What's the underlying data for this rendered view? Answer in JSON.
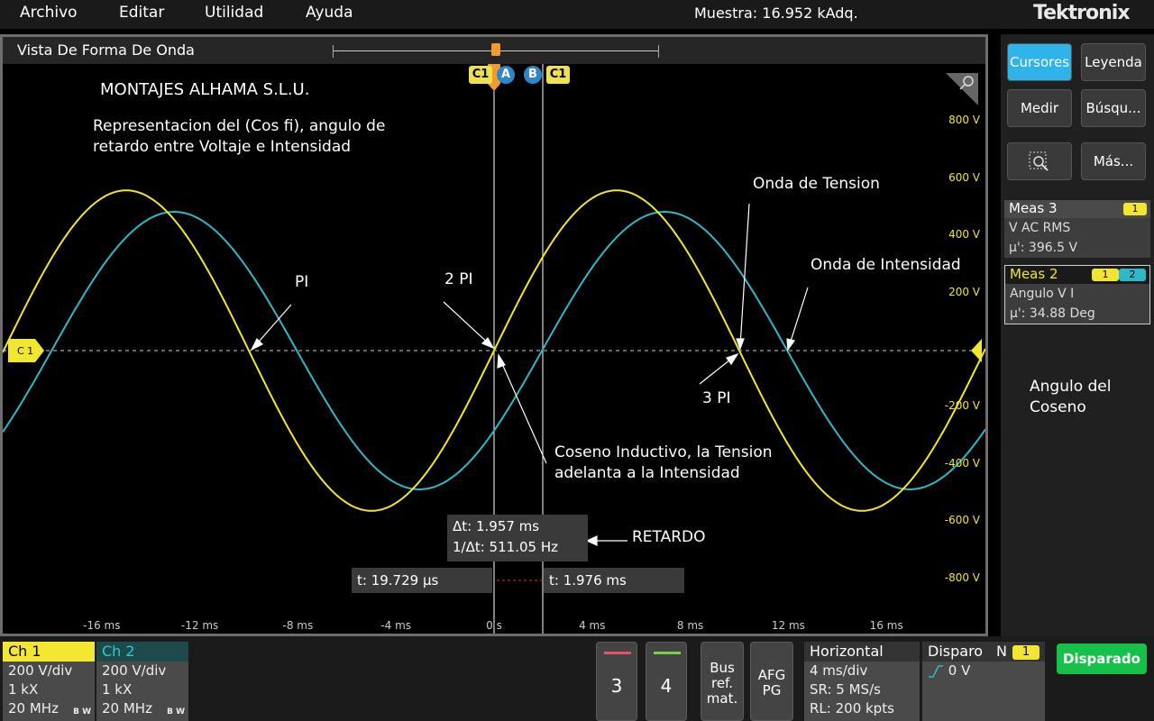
{
  "menu": [
    "Archivo",
    "Editar",
    "Utilidad",
    "Ayuda"
  ],
  "sample_info": "Muestra: 16.952 kAdq.",
  "brand": "Tektronix",
  "waveform_view": {
    "title": "Vista De Forma De Onda",
    "y_ticks": [
      "800 V",
      "600 V",
      "400 V",
      "200 V",
      "-200 V",
      "-400 V",
      "-600 V",
      "-800 V"
    ],
    "x_ticks": [
      "-16 ms",
      "-12 ms",
      "-8 ms",
      "-4 ms",
      "0 s",
      "4 ms",
      "8 ms",
      "12 ms",
      "16 ms"
    ],
    "channel_marker_left": "C 1",
    "cursor_tags": [
      "C1",
      "A",
      "B",
      "C1"
    ],
    "annotations": {
      "company": "MONTAJES ALHAMA S.L.U.",
      "description_line1": "Representacion del (Cos fi), angulo de",
      "description_line2": "retardo entre Voltaje e Intensidad",
      "pi": "PI",
      "two_pi": "2 PI",
      "three_pi": "3 PI",
      "voltage_wave": "Onda de Tension",
      "current_wave": "Onda de Intensidad",
      "inductive_line1": "Coseno Inductivo, la Tension",
      "inductive_line2": "adelanta a la Intensidad",
      "delay": "RETARDO",
      "angle_line1": "Angulo del",
      "angle_line2": "Coseno"
    },
    "readouts": {
      "delta_t": "Δt: 1.957 ms",
      "inv_delta_t": "1/Δt: 511.05 Hz",
      "cursor_a_time": "t: 19.729 µs",
      "cursor_b_time": "t: 1.976 ms"
    },
    "colors": {
      "ch1": "#f2e630",
      "ch2": "#30b8c8"
    }
  },
  "right_panel": {
    "buttons": {
      "cursors": "Cursores",
      "legend": "Leyenda",
      "measure": "Medir",
      "search": "Búsqu...",
      "more": "Más..."
    },
    "meas3": {
      "title": "Meas 3",
      "badge": "1",
      "line1": "V AC RMS",
      "line2": "µ': 396.5 V"
    },
    "meas2": {
      "title": "Meas 2",
      "badge1": "1",
      "badge2": "2",
      "line1": "Angulo V I",
      "line2": "µ': 34.88 Deg"
    }
  },
  "bottom": {
    "ch1": {
      "title": "Ch 1",
      "scale": "200 V/div",
      "impedance": "1 kX",
      "bandwidth": "20 MHz",
      "bw": "B W"
    },
    "ch2": {
      "title": "Ch 2",
      "scale": "200 V/div",
      "impedance": "1 kX",
      "bandwidth": "20 MHz",
      "bw": "B W"
    },
    "ch3": "3",
    "ch4": "4",
    "bus_ref": [
      "Bus",
      "ref.",
      "mat."
    ],
    "afg": [
      "AFG",
      "PG"
    ],
    "horizontal": {
      "title": "Horizontal",
      "scale": "4 ms/div",
      "sr": "SR: 5 MS/s",
      "rl": "RL: 200 kpts"
    },
    "trigger": {
      "title": "Disparo",
      "mode": "N",
      "badge": "1",
      "level": "0 V"
    },
    "triggered": "Disparado"
  }
}
